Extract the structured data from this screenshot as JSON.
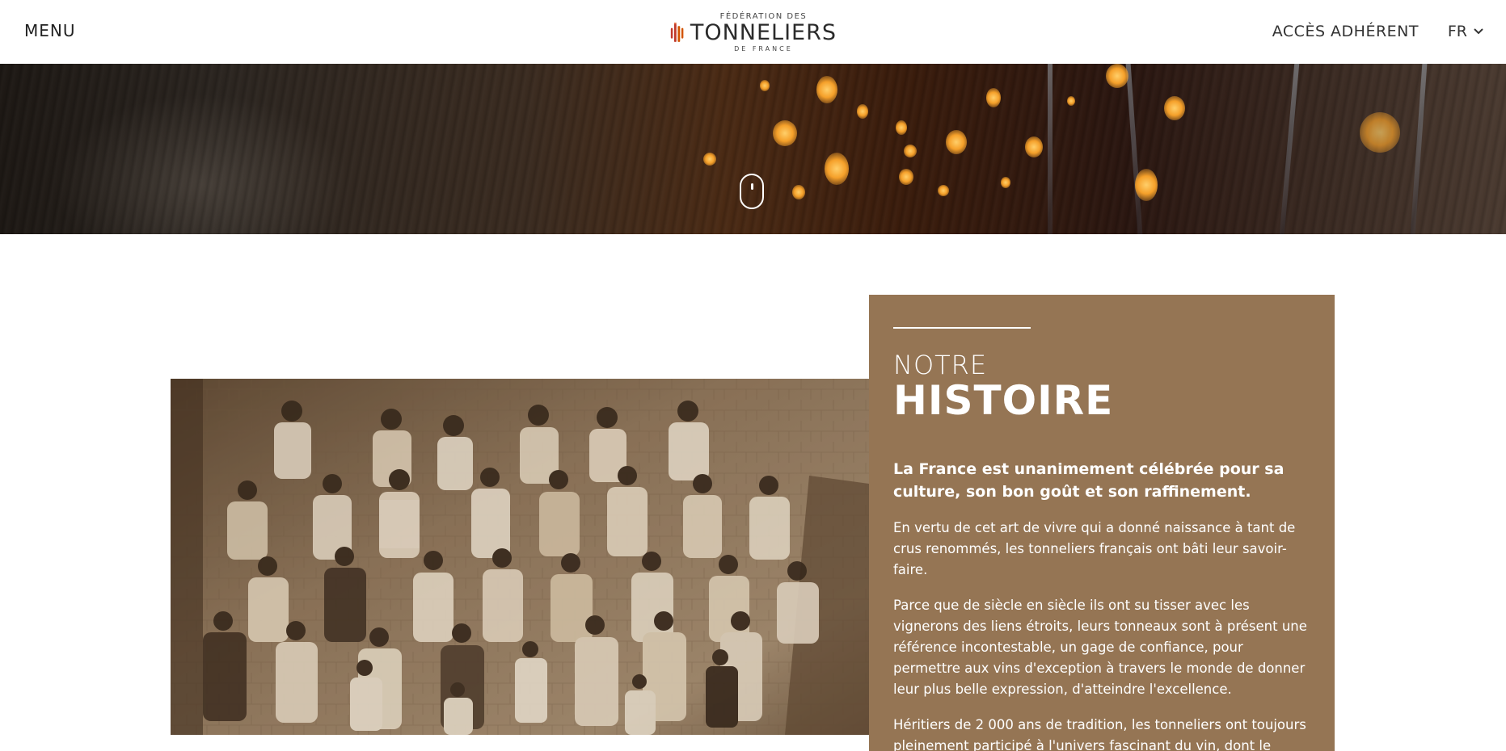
{
  "header": {
    "menu_label": "MENU",
    "logo": {
      "small_line": "FÉDÉRATION DES",
      "big_line": "TONNELIERS",
      "tiny_line": "DE FRANCE"
    },
    "member_access_label": "ACCÈS ADHÉRENT",
    "language_label": "FR"
  },
  "hero": {
    "scroll_icon": "mouse-scroll-icon"
  },
  "history": {
    "eyebrow": "NOTRE",
    "title": "HISTOIRE",
    "lead": "La France est unanimement célébrée pour sa culture, son bon goût et son raffinement.",
    "paragraphs": [
      "En vertu de cet art de vivre qui a donné naissance à tant de crus renommés, les tonneliers français ont bâti leur savoir-faire.",
      "Parce que de siècle en siècle ils ont su tisser avec les vignerons des liens étroits, leurs tonneaux sont à présent une référence incontestable, un gage de confiance, pour permettre aux vins d'exception à travers le monde de donner leur plus belle expression, d'atteindre l'excellence.",
      "Héritiers de 2 000 ans de tradition, les tonneliers ont toujours pleinement participé à l'univers fascinant du vin, dont le"
    ]
  },
  "colors": {
    "panel": "#957554",
    "logo_red": "#c0392b",
    "logo_orange": "#d35400"
  }
}
